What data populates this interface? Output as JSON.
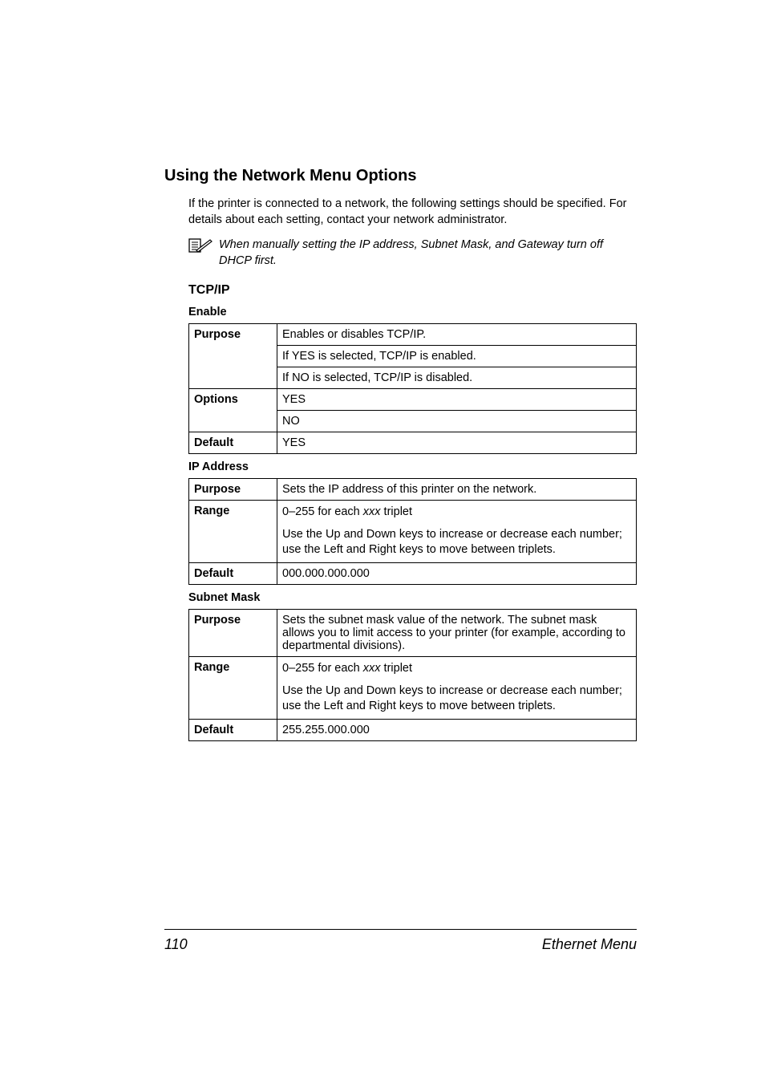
{
  "heading": "Using the Network Menu Options",
  "intro": "If the printer is connected to a network, the following settings should be specified. For details about each setting, contact your network administrator.",
  "note": "When manually setting the IP address, Subnet Mask, and Gateway turn off DHCP first.",
  "section_tcpip": "TCP/IP",
  "enable": {
    "title": "Enable",
    "purpose_label": "Purpose",
    "purpose_1": "Enables or disables TCP/IP.",
    "purpose_2": "If YES is selected, TCP/IP is enabled.",
    "purpose_3": "If NO is selected, TCP/IP is disabled.",
    "options_label": "Options",
    "options_1": "YES",
    "options_2": "NO",
    "default_label": "Default",
    "default_value": "YES"
  },
  "ip": {
    "title": "IP Address",
    "purpose_label": "Purpose",
    "purpose_value": "Sets the IP address of this printer on the network.",
    "range_label": "Range",
    "range_1_pre": "0–255 for each ",
    "range_1_em": "xxx",
    "range_1_post": " triplet",
    "range_2": "Use the Up and Down keys to increase or decrease each number; use the Left and Right keys to move between triplets.",
    "default_label": "Default",
    "default_value": "000.000.000.000"
  },
  "subnet": {
    "title": "Subnet Mask",
    "purpose_label": "Purpose",
    "purpose_value": "Sets the subnet mask value of the network. The subnet mask allows you to limit access to your printer (for example, according to departmental divisions).",
    "range_label": "Range",
    "range_1_pre": "0–255 for each ",
    "range_1_em": "xxx",
    "range_1_post": " triplet",
    "range_2": "Use the Up and Down keys to increase or decrease each number; use the Left and Right keys to move between triplets.",
    "default_label": "Default",
    "default_value": "255.255.000.000"
  },
  "footer": {
    "page": "110",
    "section": "Ethernet Menu"
  }
}
